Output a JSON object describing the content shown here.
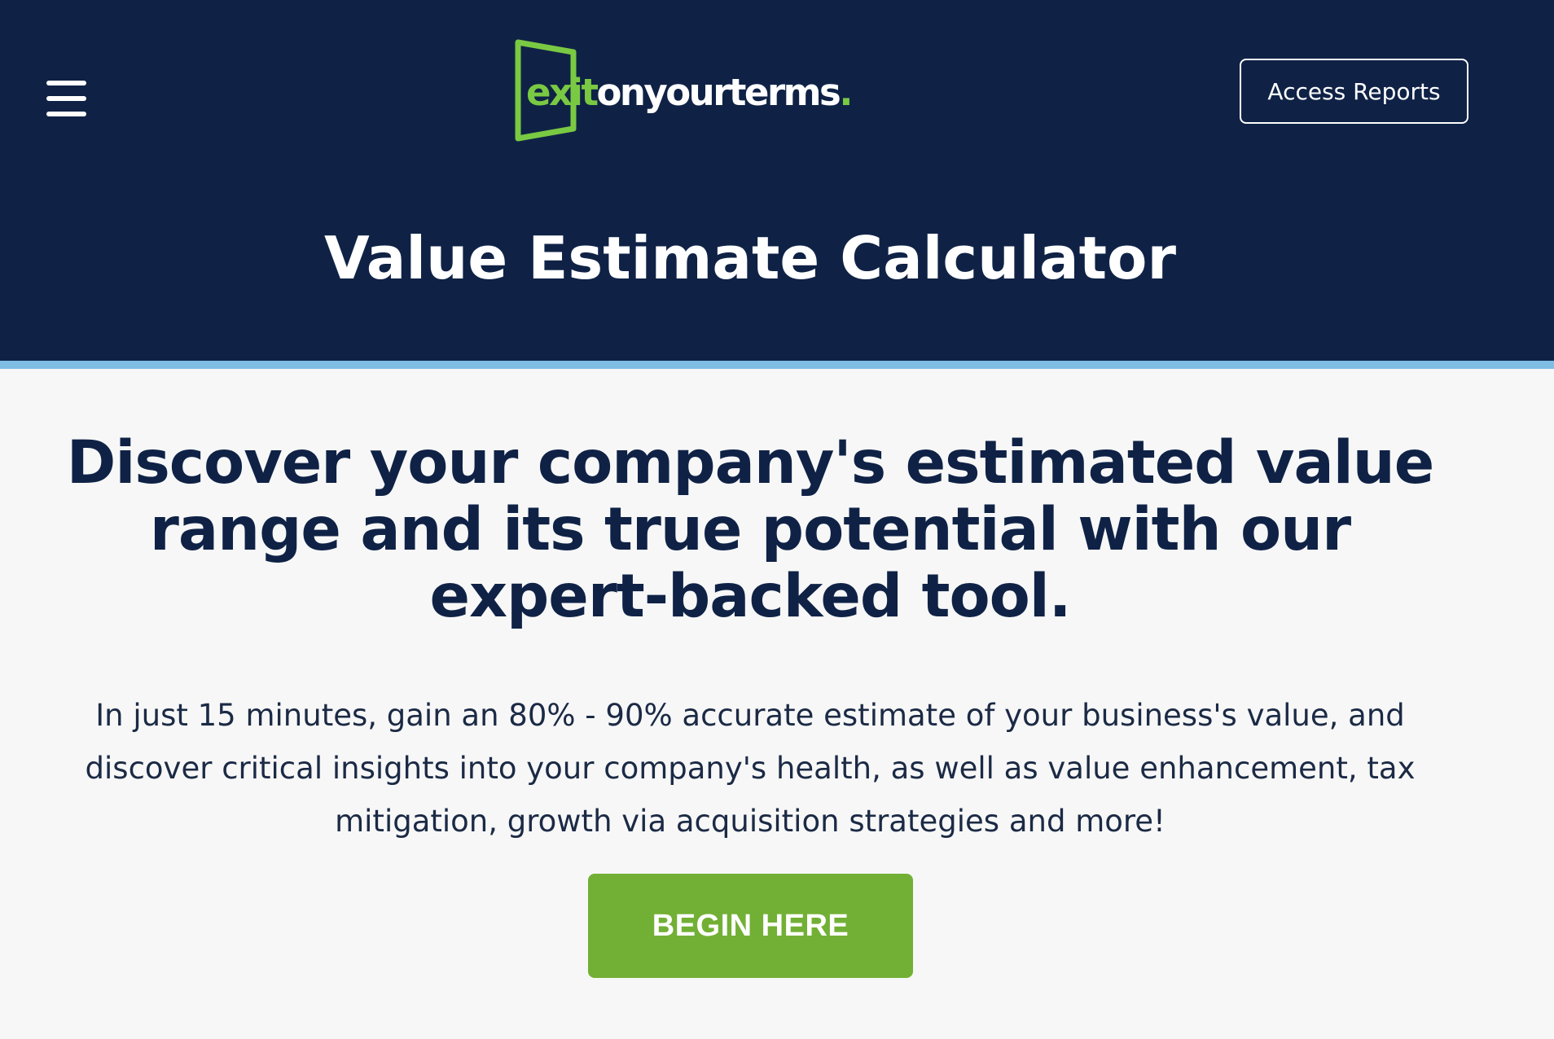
{
  "header": {
    "menu_icon": "hamburger-menu-icon",
    "logo": {
      "icon": "door-icon",
      "part_exit": "exit",
      "part_rest": "onyourterms",
      "part_dot": ".",
      "brand_color": "#7ac943"
    },
    "access_reports_label": "Access Reports",
    "page_title": "Value Estimate Calculator",
    "background_color": "#0f2246",
    "accent_strip_color": "#7fbde3"
  },
  "main": {
    "headline": "Discover your company's estimated value range and its true potential with our expert-backed tool.",
    "lede": "In just 15 minutes, gain an 80% - 90% accurate estimate of your business's value, and discover critical insights into your company's health, as well as value enhancement, tax mitigation, growth via acquisition strategies and more!",
    "cta_label": "BEGIN HERE",
    "cta_color": "#72b035"
  }
}
